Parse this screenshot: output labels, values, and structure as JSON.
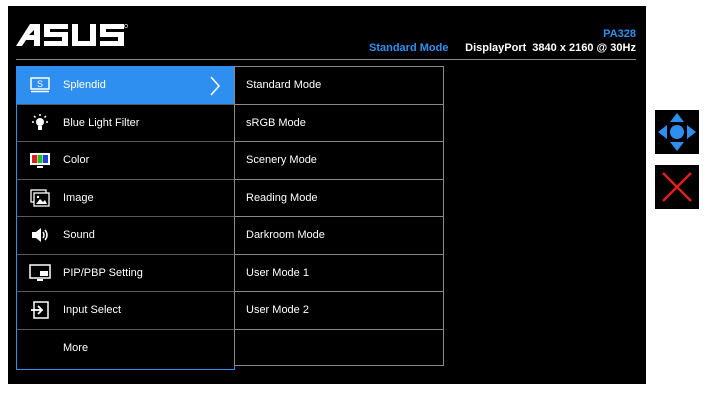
{
  "header": {
    "brand": "ASUS",
    "model": "PA328",
    "current_mode": "Standard Mode",
    "signal": {
      "input": "DisplayPort",
      "resolution": "3840 x 2160 @ 30Hz"
    }
  },
  "colors": {
    "accent": "#2f8ff0",
    "close": "#e02020",
    "background": "#000000"
  },
  "main_menu": [
    {
      "label": "Splendid",
      "icon": "splendid-icon",
      "active": true
    },
    {
      "label": "Blue Light Filter",
      "icon": "bulb-icon"
    },
    {
      "label": "Color",
      "icon": "color-icon"
    },
    {
      "label": "Image",
      "icon": "image-icon"
    },
    {
      "label": "Sound",
      "icon": "speaker-icon"
    },
    {
      "label": "PIP/PBP Setting",
      "icon": "pip-icon"
    },
    {
      "label": "Input Select",
      "icon": "input-icon"
    },
    {
      "label": "More",
      "icon": ""
    }
  ],
  "sub_menu": [
    {
      "label": "Standard Mode"
    },
    {
      "label": "sRGB Mode"
    },
    {
      "label": "Scenery Mode"
    },
    {
      "label": "Reading Mode"
    },
    {
      "label": "Darkroom Mode"
    },
    {
      "label": "User Mode 1"
    },
    {
      "label": "User Mode 2"
    },
    {
      "label": ""
    }
  ],
  "controls": {
    "nav": "nav-pad-icon",
    "close": "close-icon"
  }
}
